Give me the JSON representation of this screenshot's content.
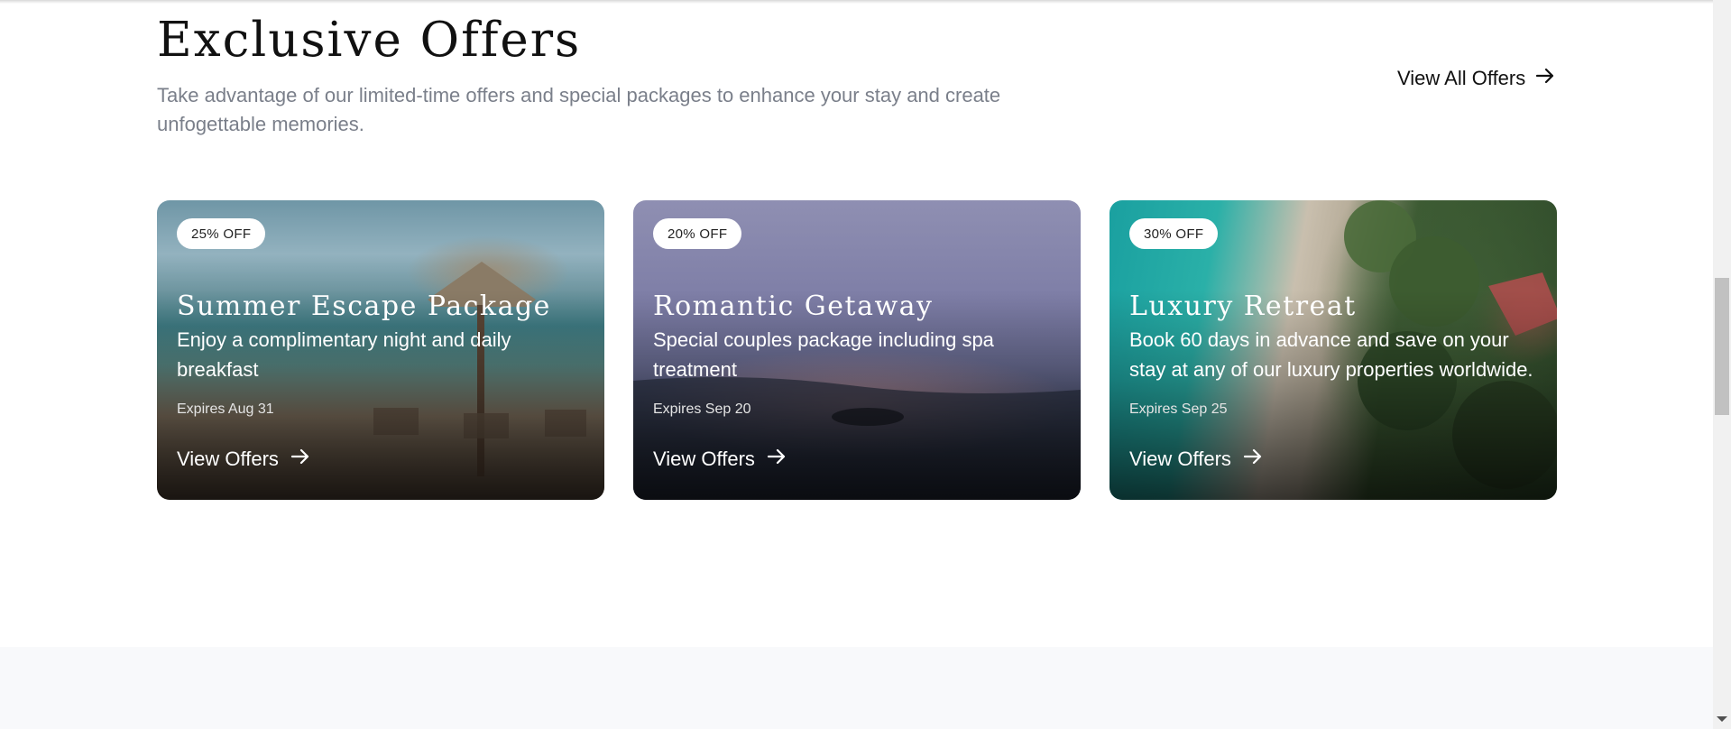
{
  "offers_section": {
    "title": "Exclusive Offers",
    "description": "Take advantage of our limited-time offers and special packages to enhance your stay and create unfogettable memories.",
    "view_all_label": "View All Offers"
  },
  "cards": [
    {
      "badge": "25% OFF",
      "title": "Summer Escape Package",
      "description": "Enjoy a complimentary night and daily breakfast",
      "expiry": "Expires Aug 31",
      "link_label": "View Offers"
    },
    {
      "badge": "20% OFF",
      "title": "Romantic Getaway",
      "description": "Special couples package including spa treatment",
      "expiry": "Expires Sep 20",
      "link_label": "View Offers"
    },
    {
      "badge": "30% OFF",
      "title": "Luxury Retreat",
      "description": "Book 60 days in advance and save on your stay at any of our luxury properties worldwide.",
      "expiry": "Expires Sep 25",
      "link_label": "View Offers"
    }
  ],
  "icons": {
    "arrow": "arrow-right-icon"
  },
  "colors": {
    "text_primary": "#111111",
    "text_muted": "#7a7f8a",
    "badge_bg": "#ffffff",
    "band_bg": "#f8f9fb"
  }
}
